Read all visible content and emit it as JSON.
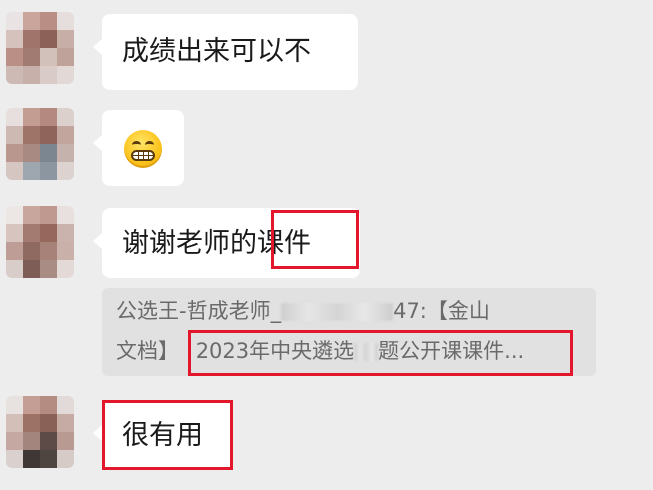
{
  "messages": [
    {
      "type": "text",
      "text": "成绩出来可以不"
    },
    {
      "type": "emoji",
      "emoji": "grimacing-face"
    },
    {
      "type": "text",
      "text_plain": "谢谢老师的",
      "text_highlight": "课件"
    },
    {
      "type": "quote",
      "line1_prefix": "公选王-哲成老师_",
      "line1_suffix": "47:【金山",
      "line2_prefix": "文档】",
      "line2_a": "2023年中央遴选",
      "line2_b": "题公开课课件..."
    },
    {
      "type": "text",
      "text": "很有用"
    }
  ],
  "annotations": {
    "highlight_color": "#e3172b"
  },
  "colors": {
    "background": "#ededed",
    "bubble": "#ffffff",
    "quote_background": "#e1e1e1",
    "quote_text": "#6a6a6a"
  }
}
